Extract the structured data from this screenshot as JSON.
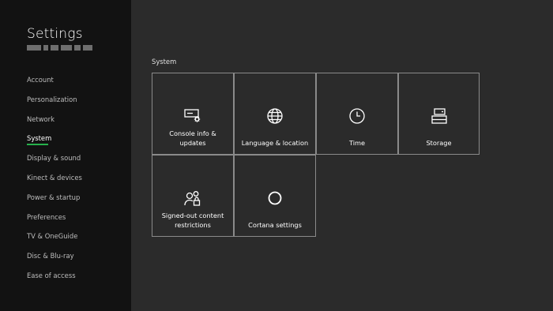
{
  "sidebar": {
    "title": "Settings",
    "items": [
      {
        "label": "Account"
      },
      {
        "label": "Personalization"
      },
      {
        "label": "Network"
      },
      {
        "label": "System",
        "active": true
      },
      {
        "label": "Display & sound"
      },
      {
        "label": "Kinect & devices"
      },
      {
        "label": "Power & startup"
      },
      {
        "label": "Preferences"
      },
      {
        "label": "TV & OneGuide"
      },
      {
        "label": "Disc & Blu-ray"
      },
      {
        "label": "Ease of access"
      }
    ]
  },
  "main": {
    "section_title": "System",
    "tiles": [
      {
        "label": "Console info & updates",
        "icon": "console-info-icon"
      },
      {
        "label": "Language & location",
        "icon": "globe-icon"
      },
      {
        "label": "Time",
        "icon": "clock-icon"
      },
      {
        "label": "Storage",
        "icon": "storage-icon"
      },
      {
        "label": "Signed-out content restrictions",
        "icon": "user-lock-icon"
      },
      {
        "label": "Cortana settings",
        "icon": "cortana-icon"
      }
    ]
  },
  "colors": {
    "background": "#2b2b2b",
    "sidebar": "#121212",
    "accent": "#26b14b",
    "tile_border": "#8a8a8a"
  }
}
